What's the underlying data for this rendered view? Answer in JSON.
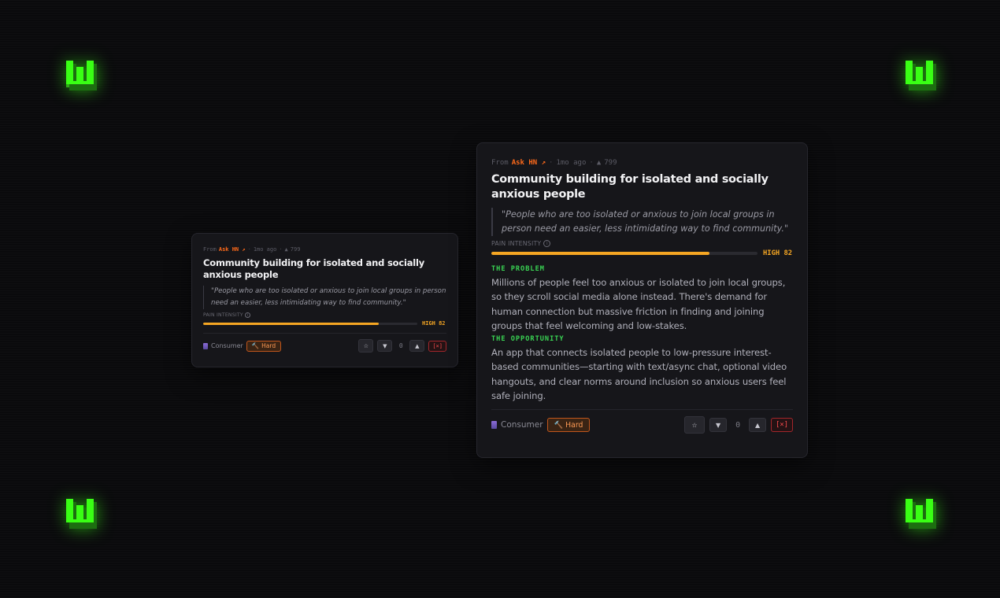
{
  "logo": {
    "letter": "W",
    "color": "#39ff14"
  },
  "idea": {
    "source_prefix": "From",
    "source_name": "Ask HN",
    "source_arrow": "↗",
    "separator": "·",
    "age": "1mo ago",
    "upvote_icon": "▲",
    "upvotes": "799",
    "title": "Community building for isolated and socially anxious people",
    "quote": "\"People who are too isolated or anxious to join local groups in person need an easier, less intimidating way to find community.\"",
    "pain_label": "PAIN INTENSITY",
    "pain_info_icon": "i",
    "pain_level_text": "HIGH 82",
    "pain_fraction": 0.82,
    "problem_heading": "THE PROBLEM",
    "problem_text": "Millions of people feel too anxious or isolated to join local groups, so they scroll social media alone instead. There's demand for human connection but massive friction in finding and joining groups that feel welcoming and low-stakes.",
    "opportunity_heading": "THE OPPORTUNITY",
    "opportunity_text": "An app that connects isolated people to low-pressure interest-based communities—starting with text/async chat, optional video hangouts, and clear norms around inclusion so anxious users feel safe joining.",
    "category": "Consumer",
    "difficulty_icon": "🔨",
    "difficulty": "Hard",
    "star_icon": "☆",
    "downvote_icon": "▼",
    "vote_count": "0",
    "upvote_button_icon": "▲",
    "delete_label": "[×]"
  },
  "colors": {
    "accent_orange": "#ff6a1a",
    "pain_bar": "#f5a623",
    "section_green": "#39d353",
    "delete_red": "#ff4d4f"
  }
}
